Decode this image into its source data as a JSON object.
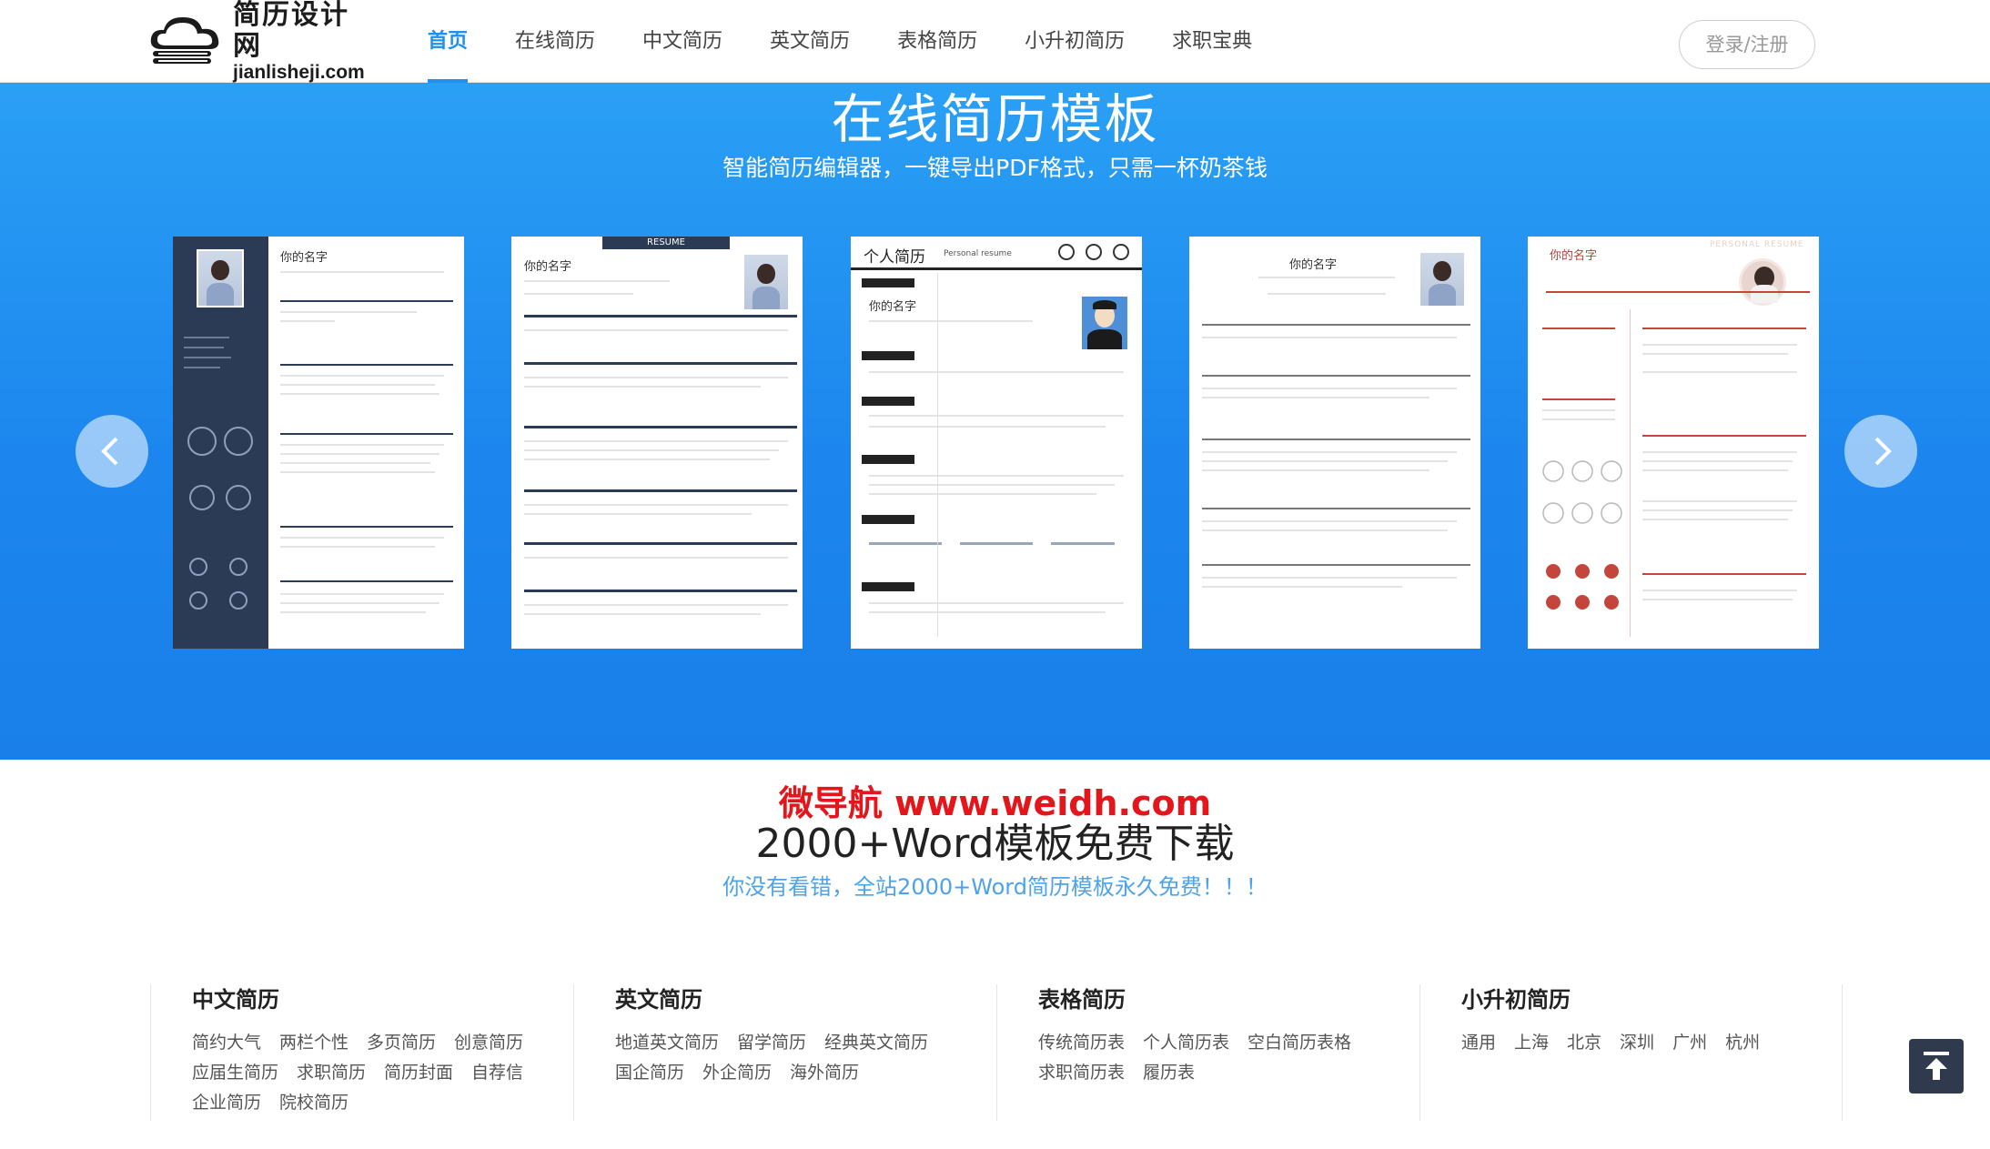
{
  "header": {
    "logo_cn": "简历设计网",
    "logo_en": "jianlisheji.com",
    "nav": [
      "首页",
      "在线简历",
      "中文简历",
      "英文简历",
      "表格简历",
      "小升初简历",
      "求职宝典"
    ],
    "active_nav": "首页",
    "login_label": "登录/注册"
  },
  "hero": {
    "title": "在线简历模板",
    "subtitle": "智能简历编辑器，一键导出PDF格式，只需一杯奶茶钱",
    "templates": [
      {
        "name": "你的名字",
        "style": "dark-sidebar"
      },
      {
        "name": "你的名字",
        "banner": "RESUME",
        "style": "banner-top"
      },
      {
        "name": "你的名字",
        "heading": "个人简历",
        "heading_en": "Personal resume",
        "style": "avatar-cartoon"
      },
      {
        "name": "你的名字",
        "style": "minimal-center"
      },
      {
        "name": "你的名字",
        "banner": "PERSONAL RESUME",
        "style": "red-accent"
      }
    ],
    "colors": {
      "gradient_top": "#2aa0f5",
      "gradient_bottom": "#1a7fe9"
    }
  },
  "watermark": "微导航 www.weidh.com",
  "promo": {
    "title": "2000+Word模板免费下载",
    "subtitle": "你没有看错，全站2000+Word简历模板永久免费！！！"
  },
  "categories": [
    {
      "title": "中文简历",
      "links": [
        "简约大气",
        "两栏个性",
        "多页简历",
        "创意简历",
        "应届生简历",
        "求职简历",
        "简历封面",
        "自荐信",
        "企业简历",
        "院校简历"
      ]
    },
    {
      "title": "英文简历",
      "links": [
        "地道英文简历",
        "留学简历",
        "经典英文简历",
        "国企简历",
        "外企简历",
        "海外简历"
      ]
    },
    {
      "title": "表格简历",
      "links": [
        "传统简历表",
        "个人简历表",
        "空白简历表格",
        "求职简历表",
        "履历表"
      ]
    },
    {
      "title": "小升初简历",
      "links": [
        "通用",
        "上海",
        "北京",
        "深圳",
        "广州",
        "杭州"
      ]
    }
  ],
  "accent_color": "#1f8ff0"
}
